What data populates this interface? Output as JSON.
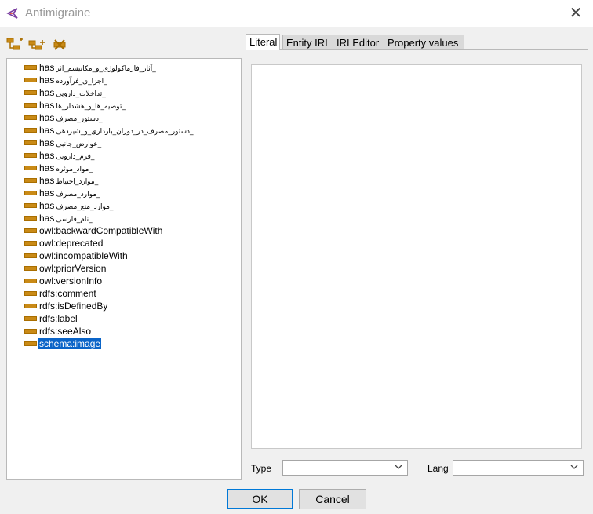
{
  "window": {
    "title": "Antimigraine",
    "close_glyph": "✕"
  },
  "toolbar": {
    "buttons": [
      "add-sub-property-icon",
      "add-sibling-property-icon",
      "delete-property-icon"
    ]
  },
  "tree": {
    "items": [
      {
        "prefix": "has",
        "arabic": "_آثار_فارماکولوژی_و_مکانیسم_اثر"
      },
      {
        "prefix": "has",
        "arabic": "_اجزا_ی_فرآورده"
      },
      {
        "prefix": "has",
        "arabic": "_تداخلات_دارویی"
      },
      {
        "prefix": "has",
        "arabic": "_توصیه_ها_و_هشدار_ها"
      },
      {
        "prefix": "has",
        "arabic": "_دستور_مصرف"
      },
      {
        "prefix": "has",
        "arabic": "_دستور_مصرف_در_دوران_بارداری_و_شیردهی"
      },
      {
        "prefix": "has",
        "arabic": "_عوارض_جانبی"
      },
      {
        "prefix": "has",
        "arabic": "_فرم_دارویی"
      },
      {
        "prefix": "has",
        "arabic": "_مواد_موثره"
      },
      {
        "prefix": "has",
        "arabic": "_موارد_احتیاط"
      },
      {
        "prefix": "has",
        "arabic": "_موارد_مصرف"
      },
      {
        "prefix": "has",
        "arabic": "_موارد_منع_مصرف"
      },
      {
        "prefix": "has",
        "arabic": "_نام_فارسی"
      },
      {
        "label": "owl:backwardCompatibleWith"
      },
      {
        "label": "owl:deprecated"
      },
      {
        "label": "owl:incompatibleWith"
      },
      {
        "label": "owl:priorVersion"
      },
      {
        "label": "owl:versionInfo"
      },
      {
        "label": "rdfs:comment"
      },
      {
        "label": "rdfs:isDefinedBy"
      },
      {
        "label": "rdfs:label"
      },
      {
        "label": "rdfs:seeAlso"
      },
      {
        "label": "schema:image",
        "selected": true
      }
    ]
  },
  "tabs": [
    "Literal",
    "Entity IRI",
    "IRI Editor",
    "Property values"
  ],
  "active_tab": "Literal",
  "form": {
    "type_label": "Type",
    "type_value": "",
    "lang_label": "Lang",
    "lang_value": ""
  },
  "buttons": {
    "ok": "OK",
    "cancel": "Cancel"
  },
  "colors": {
    "selection": "#0a64c8",
    "property_icon": "#c98a16",
    "default_button_border": "#0078d7"
  }
}
